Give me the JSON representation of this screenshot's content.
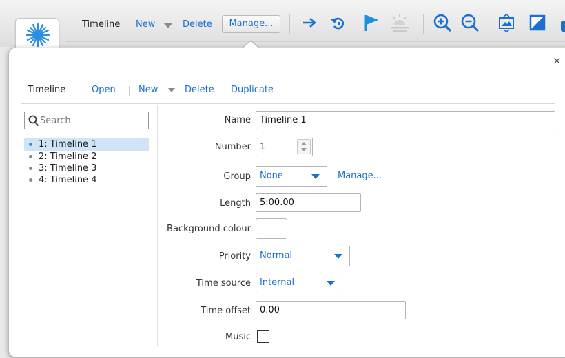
{
  "toolbar": {
    "section_label": "Timeline",
    "new_label": "New",
    "delete_label": "Delete",
    "manage_label": "Manage...",
    "icons": [
      "right-arrow-icon",
      "rotate-left-icon",
      "flag-icon",
      "sunrise-icon",
      "zoom-in-icon",
      "zoom-out-icon",
      "fit-to-window-icon",
      "contrast-icon"
    ]
  },
  "popup": {
    "close_label": "×",
    "menu": {
      "title": "Timeline",
      "open_label": "Open",
      "new_label": "New",
      "delete_label": "Delete",
      "duplicate_label": "Duplicate"
    },
    "search": {
      "placeholder": "Search"
    },
    "timelines": [
      {
        "label": "1: Timeline 1",
        "selected": true
      },
      {
        "label": "2: Timeline 2",
        "selected": false
      },
      {
        "label": "3: Timeline 3",
        "selected": false
      },
      {
        "label": "4: Timeline 4",
        "selected": false
      }
    ],
    "form": {
      "name": {
        "label": "Name",
        "value": "Timeline 1"
      },
      "number": {
        "label": "Number",
        "value": "1"
      },
      "group": {
        "label": "Group",
        "value": "None",
        "manage_label": "Manage..."
      },
      "length": {
        "label": "Length",
        "value": "5:00.00"
      },
      "background_colour": {
        "label": "Background colour",
        "value": "#ffffff"
      },
      "priority": {
        "label": "Priority",
        "value": "Normal"
      },
      "time_source": {
        "label": "Time source",
        "value": "Internal"
      },
      "time_offset": {
        "label": "Time offset",
        "value": "0.00"
      },
      "music": {
        "label": "Music",
        "checked": false
      }
    }
  },
  "colors": {
    "accent": "#1a6fd0",
    "selection": "#cfe5f7",
    "flag": "#1f8ee0"
  }
}
